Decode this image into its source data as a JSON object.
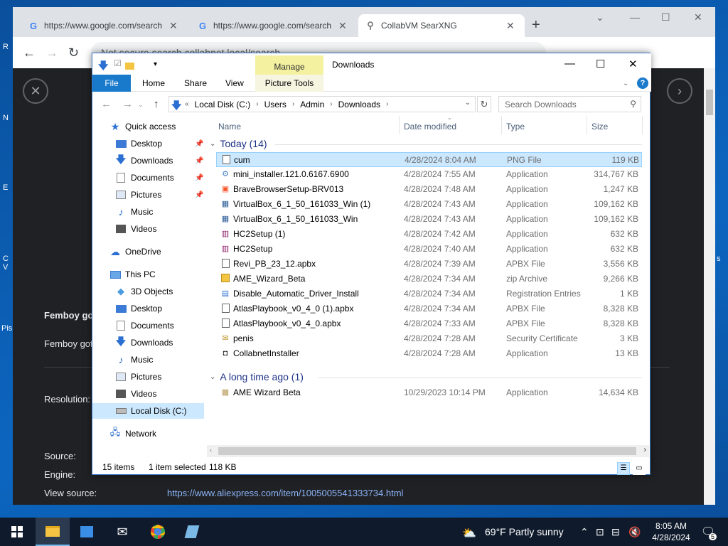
{
  "desktop": {
    "icon_labels": [
      "R",
      "N",
      "E",
      "C V",
      "Pis",
      "s"
    ]
  },
  "browser": {
    "tabs": [
      {
        "label": "https://www.google.com/search",
        "icon": "google-icon"
      },
      {
        "label": "https://www.google.com/search",
        "icon": "google-icon"
      },
      {
        "label": "CollabVM SearXNG",
        "icon": "searxng-icon"
      }
    ],
    "address_text": "Not secure   search.collabnet.local/search",
    "page": {
      "heading": "Femboy go",
      "subheading": "Femboy got",
      "resolution_label": "Resolution:",
      "source_label": "Source:",
      "engine_label": "Engine:",
      "view_source_label": "View source:",
      "view_source_url": "https://www.aliexpress.com/item/1005005541333734.html"
    }
  },
  "explorer": {
    "title": "Downloads",
    "manage_label": "Manage",
    "ribbon_tabs": {
      "file": "File",
      "home": "Home",
      "share": "Share",
      "view": "View",
      "picture_tools": "Picture Tools"
    },
    "breadcrumbs": [
      "Local Disk (C:)",
      "Users",
      "Admin",
      "Downloads"
    ],
    "search_placeholder": "Search Downloads",
    "nav": [
      {
        "label": "Quick access",
        "icon": "star-icon",
        "level": 0
      },
      {
        "label": "Desktop",
        "icon": "desktop-icon",
        "level": 1,
        "pinned": true
      },
      {
        "label": "Downloads",
        "icon": "download-icon",
        "level": 1,
        "pinned": true
      },
      {
        "label": "Documents",
        "icon": "documents-icon",
        "level": 1,
        "pinned": true
      },
      {
        "label": "Pictures",
        "icon": "pictures-icon",
        "level": 1,
        "pinned": true
      },
      {
        "label": "Music",
        "icon": "music-icon",
        "level": 1
      },
      {
        "label": "Videos",
        "icon": "videos-icon",
        "level": 1
      },
      {
        "label": "OneDrive",
        "icon": "cloud-icon",
        "level": 0
      },
      {
        "label": "This PC",
        "icon": "computer-icon",
        "level": 0
      },
      {
        "label": "3D Objects",
        "icon": "cube-icon",
        "level": 1
      },
      {
        "label": "Desktop",
        "icon": "desktop-icon",
        "level": 1
      },
      {
        "label": "Documents",
        "icon": "documents-icon",
        "level": 1
      },
      {
        "label": "Downloads",
        "icon": "download-icon",
        "level": 1
      },
      {
        "label": "Music",
        "icon": "music-icon",
        "level": 1
      },
      {
        "label": "Pictures",
        "icon": "pictures-icon",
        "level": 1
      },
      {
        "label": "Videos",
        "icon": "videos-icon",
        "level": 1
      },
      {
        "label": "Local Disk (C:)",
        "icon": "drive-icon",
        "level": 1,
        "selected": true
      },
      {
        "label": "Network",
        "icon": "network-icon",
        "level": 0
      }
    ],
    "columns": {
      "name": "Name",
      "date": "Date modified",
      "type": "Type",
      "size": "Size"
    },
    "groups": [
      {
        "label": "Today (14)",
        "files": [
          {
            "name": "cum",
            "date": "4/28/2024 8:04 AM",
            "type": "PNG File",
            "size": "119 KB",
            "icon": "image-file-icon",
            "selected": true
          },
          {
            "name": "mini_installer.121.0.6167.6900",
            "date": "4/28/2024 7:55 AM",
            "type": "Application",
            "size": "314,767 KB",
            "icon": "installer-icon"
          },
          {
            "name": "BraveBrowserSetup-BRV013",
            "date": "4/28/2024 7:48 AM",
            "type": "Application",
            "size": "1,247 KB",
            "icon": "brave-icon"
          },
          {
            "name": "VirtualBox_6_1_50_161033_Win (1)",
            "date": "4/28/2024 7:43 AM",
            "type": "Application",
            "size": "109,162 KB",
            "icon": "virtualbox-icon"
          },
          {
            "name": "VirtualBox_6_1_50_161033_Win",
            "date": "4/28/2024 7:43 AM",
            "type": "Application",
            "size": "109,162 KB",
            "icon": "virtualbox-icon"
          },
          {
            "name": "HC2Setup (1)",
            "date": "4/28/2024 7:42 AM",
            "type": "Application",
            "size": "632 KB",
            "icon": "winrar-icon"
          },
          {
            "name": "HC2Setup",
            "date": "4/28/2024 7:40 AM",
            "type": "Application",
            "size": "632 KB",
            "icon": "winrar-icon"
          },
          {
            "name": "Revi_PB_23_12.apbx",
            "date": "4/28/2024 7:39 AM",
            "type": "APBX File",
            "size": "3,556 KB",
            "icon": "blank-file-icon"
          },
          {
            "name": "AME_Wizard_Beta",
            "date": "4/28/2024 7:34 AM",
            "type": "zip Archive",
            "size": "9,266 KB",
            "icon": "zip-icon"
          },
          {
            "name": "Disable_Automatic_Driver_Install",
            "date": "4/28/2024 7:34 AM",
            "type": "Registration Entries",
            "size": "1 KB",
            "icon": "registry-icon"
          },
          {
            "name": "AtlasPlaybook_v0_4_0 (1).apbx",
            "date": "4/28/2024 7:34 AM",
            "type": "APBX File",
            "size": "8,328 KB",
            "icon": "blank-file-icon"
          },
          {
            "name": "AtlasPlaybook_v0_4_0.apbx",
            "date": "4/28/2024 7:33 AM",
            "type": "APBX File",
            "size": "8,328 KB",
            "icon": "blank-file-icon"
          },
          {
            "name": "penis",
            "date": "4/28/2024 7:28 AM",
            "type": "Security Certificate",
            "size": "3 KB",
            "icon": "certificate-icon"
          },
          {
            "name": "CollabnetInstaller",
            "date": "4/28/2024 7:28 AM",
            "type": "Application",
            "size": "13 KB",
            "icon": "app-icon"
          }
        ]
      },
      {
        "label": "A long time ago (1)",
        "files": [
          {
            "name": "AME Wizard Beta",
            "date": "10/29/2023 10:14 PM",
            "type": "Application",
            "size": "14,634 KB",
            "icon": "box-icon"
          }
        ]
      }
    ],
    "status": {
      "count": "15 items",
      "selected": "1 item selected",
      "size": "118 KB"
    }
  },
  "taskbar": {
    "weather": "69°F  Partly sunny",
    "time": "8:05 AM",
    "date": "4/28/2024",
    "notification_count": "5"
  }
}
